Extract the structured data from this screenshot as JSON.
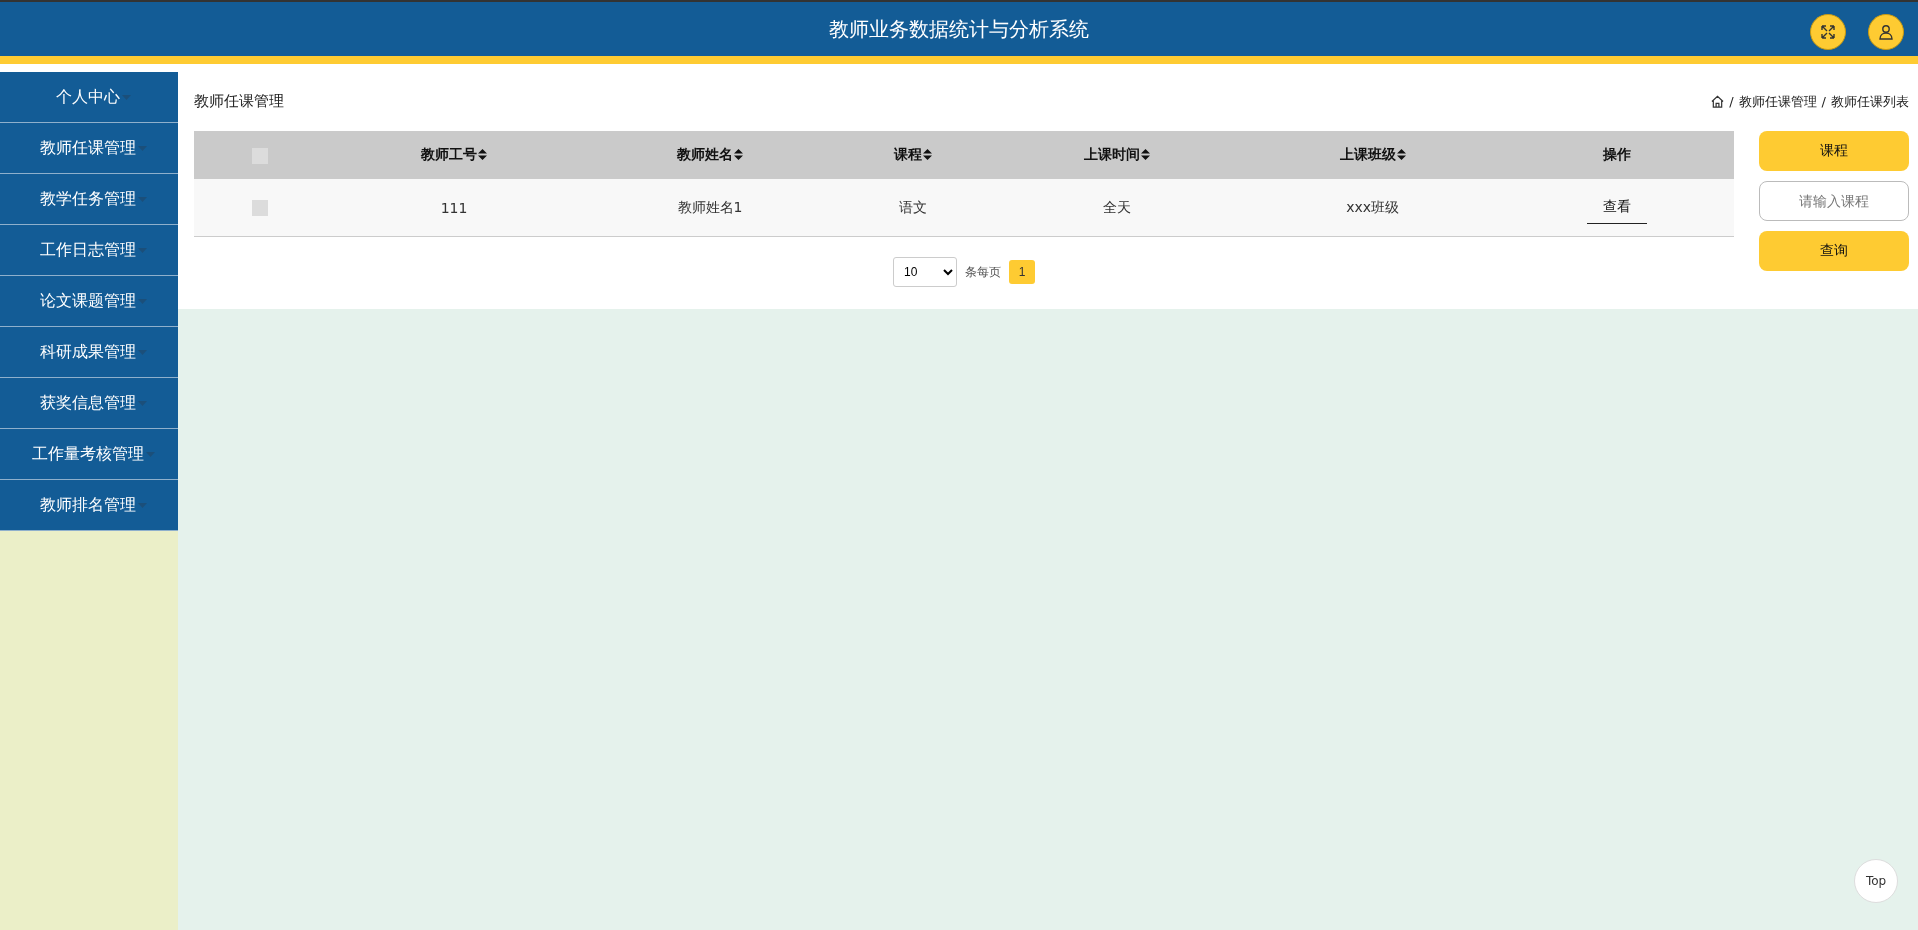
{
  "header": {
    "title": "教师业务数据统计与分析系统"
  },
  "sidebar": {
    "items": [
      {
        "label": "个人中心"
      },
      {
        "label": "教师任课管理"
      },
      {
        "label": "教学任务管理"
      },
      {
        "label": "工作日志管理"
      },
      {
        "label": "论文课题管理"
      },
      {
        "label": "科研成果管理"
      },
      {
        "label": "获奖信息管理"
      },
      {
        "label": "工作量考核管理"
      },
      {
        "label": "教师排名管理"
      }
    ]
  },
  "page": {
    "title": "教师任课管理",
    "breadcrumb": [
      {
        "separator": "/",
        "label": "教师任课管理"
      },
      {
        "separator": "/",
        "label": "教师任课列表"
      }
    ]
  },
  "table": {
    "header_checked": false,
    "columns": [
      {
        "label": "教师工号",
        "sortable": true
      },
      {
        "label": "教师姓名",
        "sortable": true
      },
      {
        "label": "课程",
        "sortable": true
      },
      {
        "label": "上课时间",
        "sortable": true
      },
      {
        "label": "上课班级",
        "sortable": true
      },
      {
        "label": "操作",
        "sortable": false
      }
    ],
    "rows": [
      {
        "checked": false,
        "cells": [
          "111",
          "教师姓名1",
          "语文",
          "全天",
          "xxx班级"
        ],
        "action": "查看"
      }
    ]
  },
  "pagination": {
    "page_size": "10",
    "per_page_label": "条每页",
    "pages": [
      {
        "label": "1",
        "selected": true
      }
    ]
  },
  "search": {
    "category_button": "课程",
    "placeholder": "请输入课程",
    "submit": "查询"
  },
  "top_button": "Top"
}
